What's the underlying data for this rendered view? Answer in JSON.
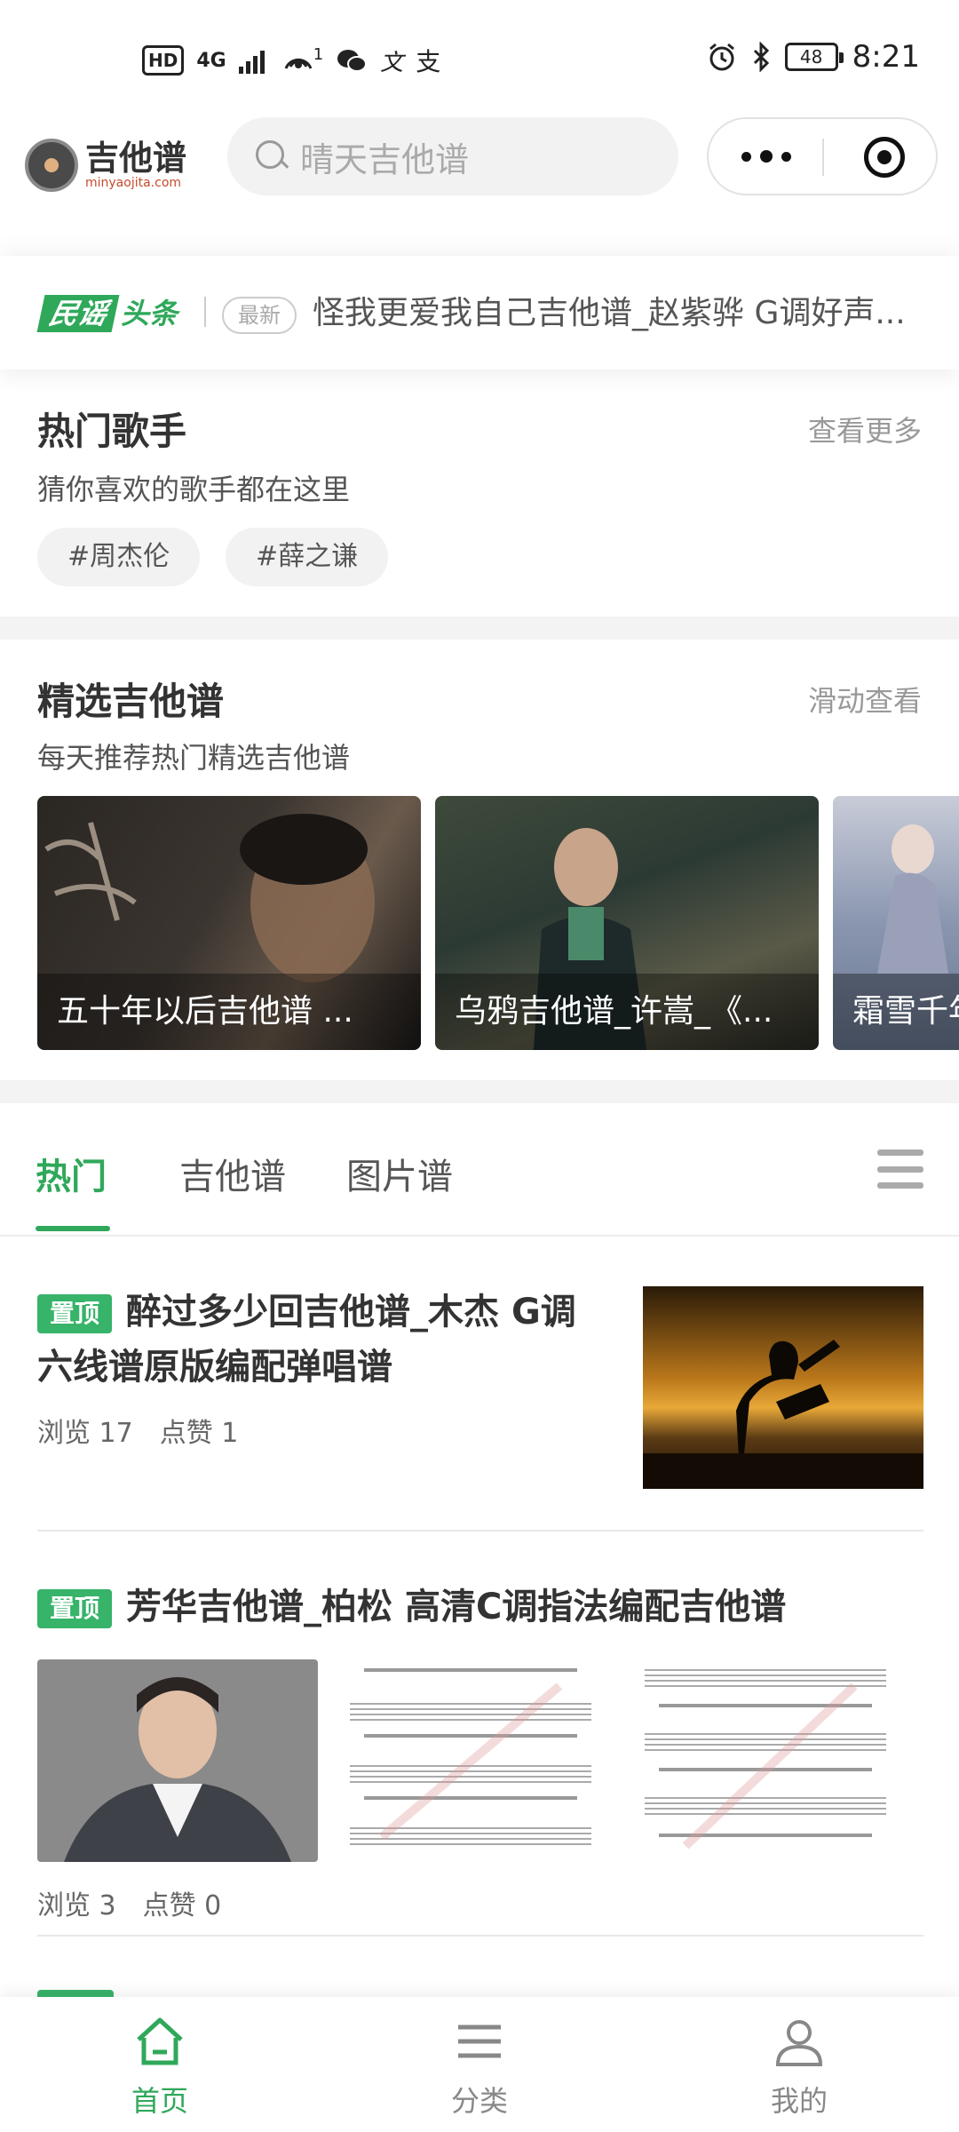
{
  "status_bar": {
    "left_indicators": [
      "HD",
      "4G",
      "1",
      "WeChat",
      "文",
      "支"
    ],
    "battery": "48",
    "time": "8:21"
  },
  "header": {
    "logo_title": "吉他谱",
    "logo_sub": "minyaojita.com",
    "search_placeholder": "晴天吉他谱"
  },
  "news": {
    "brand_a": "民谣",
    "brand_b": "头条",
    "badge": "最新",
    "headline": "怪我更爱我自己吉他谱_赵紫骅 G调好声..."
  },
  "hot_singers": {
    "title": "热门歌手",
    "more": "查看更多",
    "subtitle": "猜你喜欢的歌手都在这里",
    "tags": [
      "#周杰伦",
      "#薛之谦"
    ]
  },
  "featured": {
    "title": "精选吉他谱",
    "more": "滑动查看",
    "subtitle": "每天推荐热门精选吉他谱",
    "cards": [
      {
        "caption": "五十年以后吉他谱 ..."
      },
      {
        "caption": "乌鸦吉他谱_许嵩_《..."
      },
      {
        "caption": "霜雪千年"
      }
    ]
  },
  "tabs": [
    "热门",
    "吉他谱",
    "图片谱"
  ],
  "articles": [
    {
      "pin": "置顶",
      "title": "醉过多少回吉他谱_木杰 G调六线谱原版编配弹唱谱",
      "views": "浏览 17",
      "likes": "点赞 1"
    },
    {
      "pin": "置顶",
      "title": "芳华吉他谱_柏松 高清C调指法编配吉他谱",
      "views": "浏览 3",
      "likes": "点赞 0"
    }
  ],
  "bottom_nav": [
    {
      "label": "首页",
      "icon": "home-icon"
    },
    {
      "label": "分类",
      "icon": "category-icon"
    },
    {
      "label": "我的",
      "icon": "profile-icon"
    }
  ],
  "colors": {
    "accent": "#2fa85a",
    "pin": "#37b36a"
  }
}
